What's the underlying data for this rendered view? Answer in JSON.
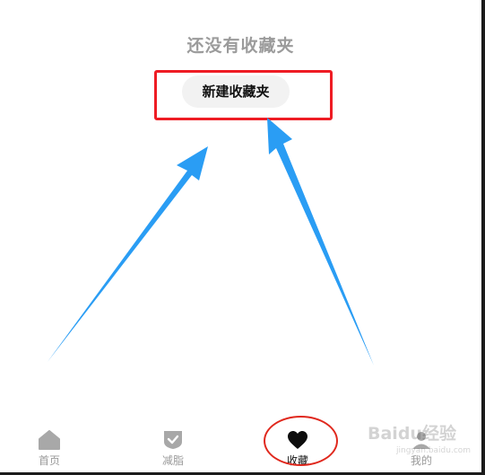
{
  "empty_state": {
    "title": "还没有收藏夹",
    "new_folder_label": "新建收藏夹"
  },
  "annotation": {
    "highlight_color": "#ee1c24",
    "arrow_color": "#2a9df4"
  },
  "tabbar": {
    "tabs": [
      {
        "label": "首页",
        "icon": "home-icon",
        "active": false
      },
      {
        "label": "减脂",
        "icon": "shield-check-icon",
        "active": false
      },
      {
        "label": "收藏",
        "icon": "heart-icon",
        "active": true
      },
      {
        "label": "我的",
        "icon": "profile-icon",
        "active": false
      }
    ]
  },
  "watermark": {
    "text": "Baidu经验",
    "sub": "jingyan.baidu.com"
  }
}
